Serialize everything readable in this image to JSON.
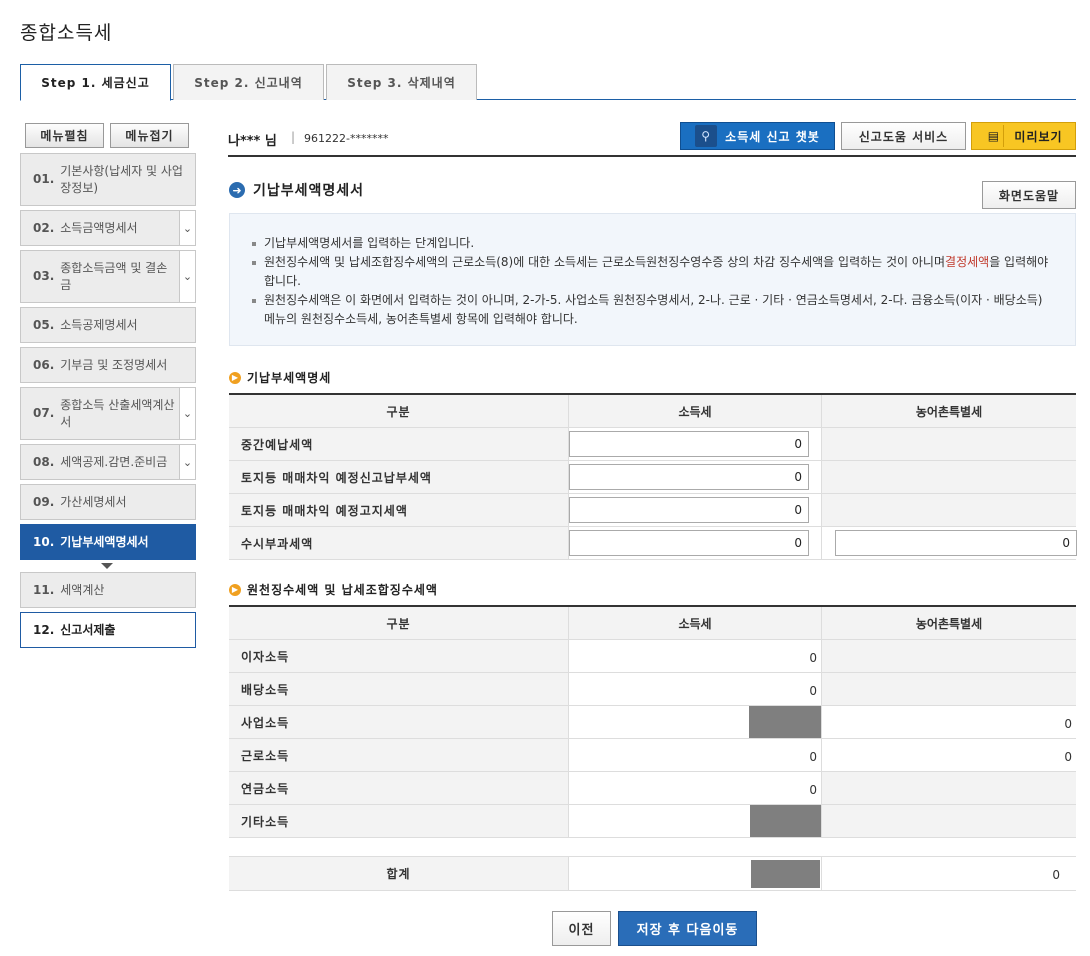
{
  "page_title": "종합소득세",
  "tabs": [
    {
      "label": "Step 1. 세금신고",
      "active": true
    },
    {
      "label": "Step 2. 신고내역",
      "active": false
    },
    {
      "label": "Step 3. 삭제내역",
      "active": false
    }
  ],
  "sidebar": {
    "expand_all": "메뉴펼침",
    "collapse_all": "메뉴접기",
    "items": [
      {
        "num": "01.",
        "label": "기본사항(납세자 및 사업장정보)"
      },
      {
        "num": "02.",
        "label": "소득금액명세서"
      },
      {
        "num": "03.",
        "label": "종합소득금액 및 결손금"
      },
      {
        "num": "05.",
        "label": "소득공제명세서"
      },
      {
        "num": "06.",
        "label": "기부금 및 조정명세서"
      },
      {
        "num": "07.",
        "label": "종합소득 산출세액계산서"
      },
      {
        "num": "08.",
        "label": "세액공제.감면.준비금"
      },
      {
        "num": "09.",
        "label": "가산세명세서"
      },
      {
        "num": "10.",
        "label": "기납부세액명세서"
      },
      {
        "num": "11.",
        "label": "세액계산"
      },
      {
        "num": "12.",
        "label": "신고서제출"
      }
    ]
  },
  "user": {
    "name": "나*** 님",
    "separator": "|",
    "id": "961222-*******"
  },
  "toolbar": {
    "chatbot": "소득세 신고 챗봇",
    "help_service": "신고도움 서비스",
    "preview": "미리보기",
    "screen_help": "화면도움말"
  },
  "section_title": "기납부세액명세서",
  "info": {
    "line1": "기납부세액명세서를 입력하는 단계입니다.",
    "line2_a": "원천징수세액 및 납세조합징수세액의 근로소득(8)에 대한 소득세는 근로소득원천징수영수증 상의 차감 징수세액을 입력하는 것이 아니며",
    "line2_red": "결정세액",
    "line2_b": "을 입력해야 합니다.",
    "line3": "원천징수세액은 이 화면에서 입력하는 것이 아니며, 2-가-5. 사업소득 원천징수명세서, 2-나. 근로 · 기타 · 연금소득명세서, 2-다. 금융소득(이자 · 배당소득) 메뉴의 원천징수소득세, 농어촌특별세 항목에 입력해야 합니다."
  },
  "table1": {
    "title": "기납부세액명세",
    "headers": [
      "구분",
      "소득세",
      "농어촌특별세"
    ],
    "rows": [
      {
        "label": "중간예납세액",
        "income_tax": "0",
        "rural_tax": ""
      },
      {
        "label": "토지등 매매차익 예정신고납부세액",
        "income_tax": "0",
        "rural_tax": ""
      },
      {
        "label": "토지등 매매차익 예정고지세액",
        "income_tax": "0",
        "rural_tax": ""
      },
      {
        "label": "수시부과세액",
        "income_tax": "0",
        "rural_tax": "0"
      }
    ]
  },
  "table2": {
    "title": "원천징수세액 및 납세조합징수세액",
    "headers": [
      "구분",
      "소득세",
      "농어촌특별세"
    ],
    "rows": [
      {
        "label": "이자소득",
        "income_tax": "0",
        "rural_tax": ""
      },
      {
        "label": "배당소득",
        "income_tax": "0",
        "rural_tax": ""
      },
      {
        "label": "사업소득",
        "income_tax": "",
        "rural_tax": "0"
      },
      {
        "label": "근로소득",
        "income_tax": "0",
        "rural_tax": "0"
      },
      {
        "label": "연금소득",
        "income_tax": "0",
        "rural_tax": ""
      },
      {
        "label": "기타소득",
        "income_tax": "",
        "rural_tax": ""
      }
    ],
    "total": {
      "label": "합계",
      "income_tax": "",
      "rural_tax": "0"
    }
  },
  "footer": {
    "prev": "이전",
    "save_next": "저장 후 다음이동"
  },
  "colors": {
    "primary_blue": "#1f5ba3",
    "preview_yellow": "#f8c623",
    "highlight_red": "#c0392b",
    "disabled_gray": "#7f7f7f"
  }
}
